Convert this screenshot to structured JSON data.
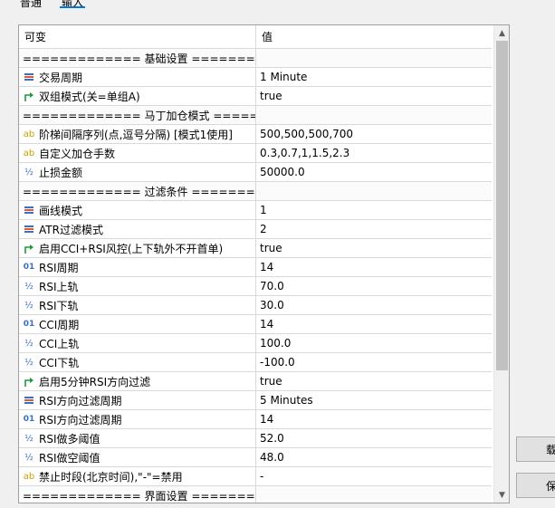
{
  "tabs": [
    {
      "label": "普通"
    },
    {
      "label": "输入"
    }
  ],
  "columns": {
    "variable": "可变",
    "value": "值"
  },
  "rows": [
    {
      "type": "sep",
      "icon": "",
      "name": "============= 基础设置 ==========...",
      "value": ""
    },
    {
      "type": "item",
      "icon": "list-icon",
      "name": "交易周期",
      "value": "1 Minute"
    },
    {
      "type": "item",
      "icon": "bool-arrow-icon",
      "name": "双组模式(关=单组A)",
      "value": "true"
    },
    {
      "type": "sep",
      "icon": "",
      "name": "============= 马丁加仓模式 =======...",
      "value": ""
    },
    {
      "type": "item",
      "icon": "ab-icon",
      "name": "阶梯间隔序列(点,逗号分隔) [模式1使用]",
      "value": "500,500,500,700"
    },
    {
      "type": "item",
      "icon": "ab-icon",
      "name": "自定义加仓手数",
      "value": "0.3,0.7,1,1.5,2.3"
    },
    {
      "type": "item",
      "icon": "half-icon",
      "name": "止损金额",
      "value": "50000.0"
    },
    {
      "type": "sep",
      "icon": "",
      "name": "============= 过滤条件 ==========...",
      "value": ""
    },
    {
      "type": "item",
      "icon": "list-icon",
      "name": "画线模式",
      "value": "1"
    },
    {
      "type": "item",
      "icon": "list-icon",
      "name": "ATR过滤模式",
      "value": "2"
    },
    {
      "type": "item",
      "icon": "bool-arrow-icon",
      "name": "启用CCI+RSI风控(上下轨外不开首单)",
      "value": "true"
    },
    {
      "type": "item",
      "icon": "int-icon",
      "name": "RSI周期",
      "value": "14"
    },
    {
      "type": "item",
      "icon": "half-icon",
      "name": "RSI上轨",
      "value": "70.0"
    },
    {
      "type": "item",
      "icon": "half-icon",
      "name": "RSI下轨",
      "value": "30.0"
    },
    {
      "type": "item",
      "icon": "int-icon",
      "name": "CCI周期",
      "value": "14"
    },
    {
      "type": "item",
      "icon": "half-icon",
      "name": "CCI上轨",
      "value": "100.0"
    },
    {
      "type": "item",
      "icon": "half-icon",
      "name": "CCI下轨",
      "value": "-100.0"
    },
    {
      "type": "item",
      "icon": "bool-arrow-icon",
      "name": "启用5分钟RSI方向过滤",
      "value": "true"
    },
    {
      "type": "item",
      "icon": "list-icon",
      "name": "RSI方向过滤周期",
      "value": "5 Minutes"
    },
    {
      "type": "item",
      "icon": "int-icon",
      "name": "RSI方向过滤周期",
      "value": "14"
    },
    {
      "type": "item",
      "icon": "half-icon",
      "name": "RSI做多阈值",
      "value": "52.0"
    },
    {
      "type": "item",
      "icon": "half-icon",
      "name": "RSI做空阈值",
      "value": "48.0"
    },
    {
      "type": "item",
      "icon": "ab-icon",
      "name": "禁止时段(北京时间),\"-\"=禁用",
      "value": "-"
    },
    {
      "type": "sep",
      "icon": "",
      "name": "============= 界面设置 ==========...",
      "value": ""
    }
  ],
  "side_buttons": [
    {
      "label": "载"
    },
    {
      "label": "保"
    }
  ]
}
